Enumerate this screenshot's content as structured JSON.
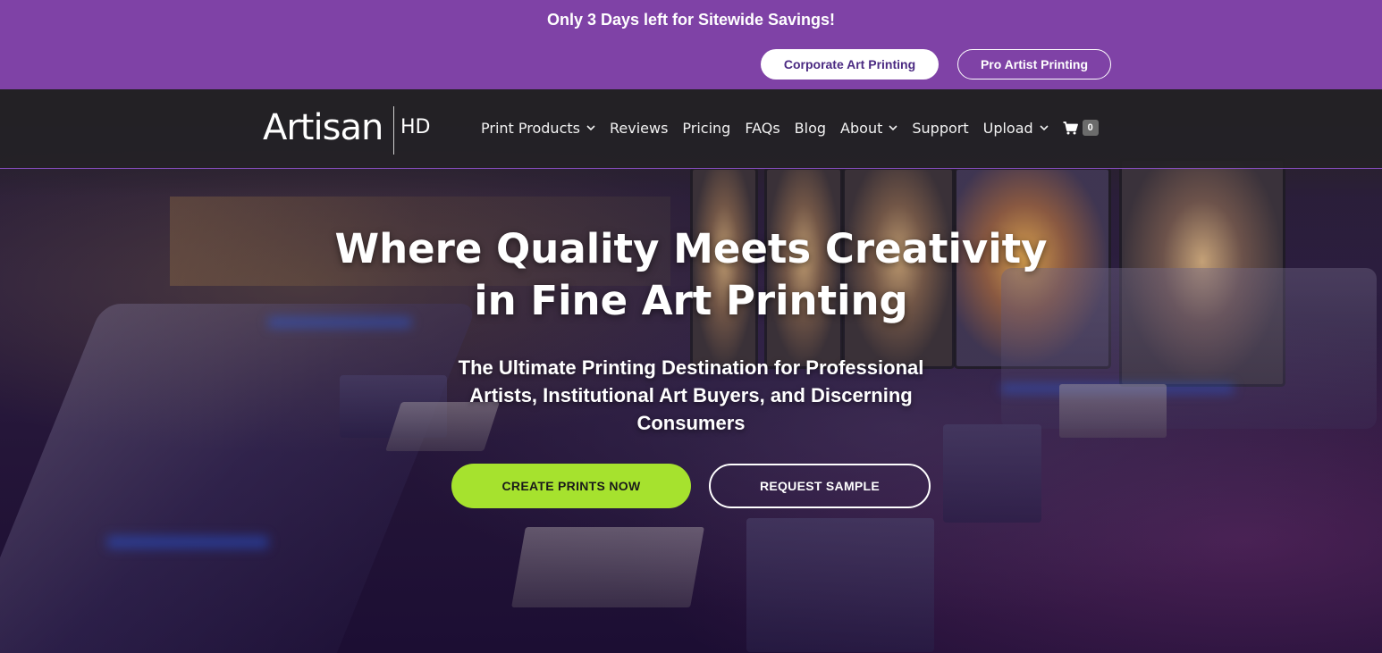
{
  "promo": {
    "message": "Only 3 Days left for Sitewide Savings!",
    "corporate_button": "Corporate Art Printing",
    "pro_button": "Pro Artist Printing"
  },
  "brand": {
    "logo_text": "Artisan",
    "logo_suffix": "HD"
  },
  "nav": {
    "items": [
      {
        "label": "Print Products",
        "has_dropdown": true
      },
      {
        "label": "Reviews",
        "has_dropdown": false
      },
      {
        "label": "Pricing",
        "has_dropdown": false
      },
      {
        "label": "FAQs",
        "has_dropdown": false
      },
      {
        "label": "Blog",
        "has_dropdown": false
      },
      {
        "label": "About",
        "has_dropdown": true
      },
      {
        "label": "Support",
        "has_dropdown": false
      },
      {
        "label": "Upload",
        "has_dropdown": true
      }
    ],
    "cart_icon": "shopping-cart-icon",
    "cart_count": "0"
  },
  "hero": {
    "title_line1": "Where Quality Meets Creativity",
    "title_line2": "in Fine Art Printing",
    "subtitle_line1": "The Ultimate Printing Destination for Professional",
    "subtitle_line2": "Artists, Institutional Art Buyers, and Discerning",
    "subtitle_line3": "Consumers",
    "primary_cta": "CREATE PRINTS NOW",
    "secondary_cta": "REQUEST SAMPLE"
  },
  "colors": {
    "promo_bg": "#7f42a6",
    "accent_green": "#a6e22e",
    "nav_bg": "#232126"
  }
}
